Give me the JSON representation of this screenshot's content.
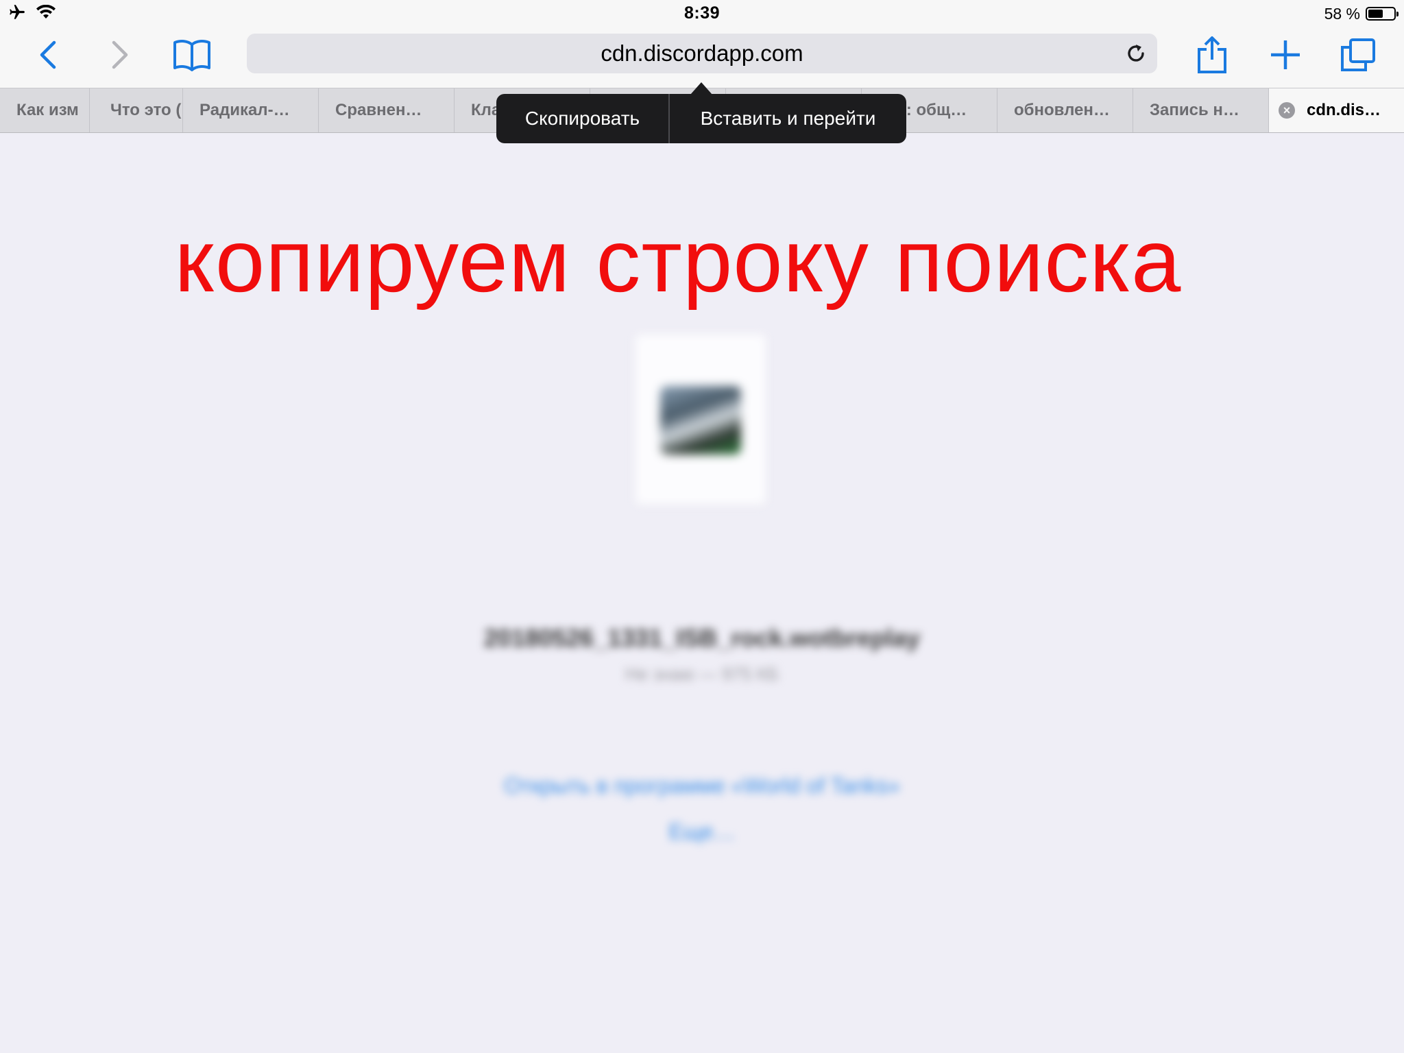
{
  "status_bar": {
    "time": "8:39",
    "battery_percent_label": "58 %",
    "battery_level": 0.58
  },
  "toolbar": {
    "address": "cdn.discordapp.com",
    "accent_color": "#1a7ae0"
  },
  "tabs": [
    {
      "label": "Как изм"
    },
    {
      "label": "Что это ("
    },
    {
      "label": "Радикал-…"
    },
    {
      "label": "Сравнен…"
    },
    {
      "label": "Кла"
    },
    {
      "label": ""
    },
    {
      "label": ""
    },
    {
      "label": "Л: общ…"
    },
    {
      "label": "обновлен…"
    },
    {
      "label": "Запись н…"
    },
    {
      "label": "cdn.dis…",
      "active": true
    }
  ],
  "context_menu": {
    "copy_label": "Скопировать",
    "paste_go_label": "Вставить и перейти"
  },
  "annotation": {
    "text": "копируем строку поиска",
    "color": "#f10d0d"
  },
  "content": {
    "file_name": "20180526_1331_ISB_rock.wotbreplay",
    "file_meta": "Не знаю — 975 КБ",
    "open_link": "Открыть в программе «World of Tanks»",
    "more_link": "Еще…"
  }
}
